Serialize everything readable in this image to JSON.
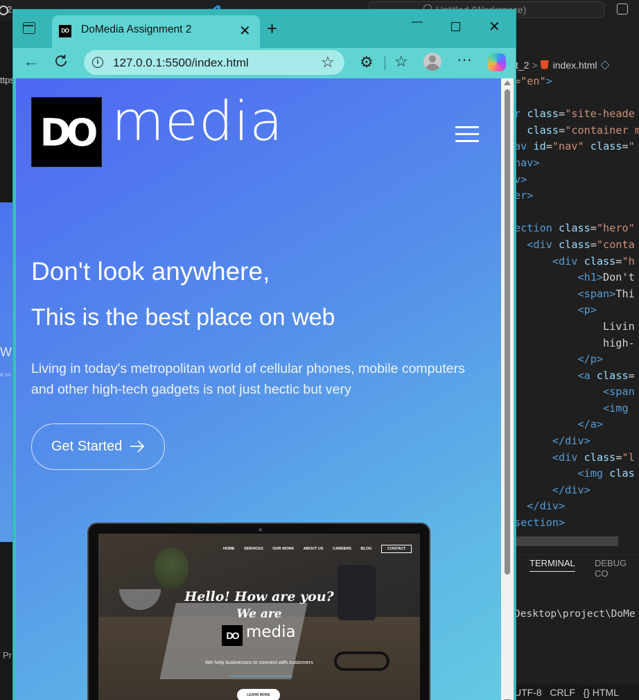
{
  "background": {
    "vscode": {
      "tab_number": "2",
      "workspace_search": "Untitled (Workspace)",
      "left_fragment_url": "ttps",
      "left_fragment_heading": "W",
      "left_fragment_small": "e co",
      "left_fragment_footer": "Pr",
      "editor_tab": {
        "left_text": "t_2",
        "file": "index.html"
      },
      "code_lines": [
        {
          "indent": 0,
          "html": "<span class='str'>=\"en\"</span><span class='tag'>&gt;</span>"
        },
        {
          "indent": 0,
          "html": " "
        },
        {
          "indent": 0,
          "html": "<span class='tag'>r</span> <span class='attr'>class</span>=<span class='str'>\"site-heade</span>"
        },
        {
          "indent": 0,
          "html": "  <span class='attr'>class</span>=<span class='str'>\"container m</span>"
        },
        {
          "indent": 0,
          "html": "<span class='tag'>av</span> <span class='attr'>id</span>=<span class='str'>\"nav\"</span> <span class='attr'>class</span>=<span class='str'>\"</span>"
        },
        {
          "indent": 0,
          "html": "<span class='tag'>nav&gt;</span>"
        },
        {
          "indent": 0,
          "html": "<span class='tag'>v&gt;</span>"
        },
        {
          "indent": 0,
          "html": "<span class='tag'>er&gt;</span>"
        },
        {
          "indent": 0,
          "html": " "
        },
        {
          "indent": 0,
          "html": "<span class='tag'>ection</span> <span class='attr'>class</span>=<span class='str'>\"hero\"</span>"
        },
        {
          "indent": 1,
          "html": "<span class='tag'>&lt;div</span> <span class='attr'>class</span>=<span class='str'>\"conta</span>"
        },
        {
          "indent": 2,
          "html": "<span class='tag'>&lt;div</span> <span class='attr'>class</span>=<span class='str'>\"h</span>"
        },
        {
          "indent": 3,
          "html": "<span class='tag'>&lt;h1&gt;</span><span class='txt'>Don't</span>"
        },
        {
          "indent": 3,
          "html": "<span class='tag'>&lt;span&gt;</span><span class='txt'>Thi</span>"
        },
        {
          "indent": 3,
          "html": "<span class='tag'>&lt;p&gt;</span>"
        },
        {
          "indent": 4,
          "html": "<span class='txt'>Livin</span>"
        },
        {
          "indent": 4,
          "html": "<span class='txt'>high-</span>"
        },
        {
          "indent": 3,
          "html": "<span class='tag'>&lt;/p&gt;</span>"
        },
        {
          "indent": 3,
          "html": "<span class='tag'>&lt;a</span> <span class='attr'>class</span>="
        },
        {
          "indent": 4,
          "html": "<span class='tag'>&lt;span</span>"
        },
        {
          "indent": 4,
          "html": "<span class='tag'>&lt;img</span>"
        },
        {
          "indent": 3,
          "html": "<span class='tag'>&lt;/a&gt;</span>"
        },
        {
          "indent": 2,
          "html": "<span class='tag'>&lt;/div&gt;</span>"
        },
        {
          "indent": 2,
          "html": "<span class='tag'>&lt;div</span> <span class='attr'>class</span>=<span class='str'>\"l</span>"
        },
        {
          "indent": 3,
          "html": "<span class='tag'>&lt;img</span> <span class='attr'>clas</span>"
        },
        {
          "indent": 2,
          "html": "<span class='tag'>&lt;/div&gt;</span>"
        },
        {
          "indent": 1,
          "html": "<span class='tag'>&lt;/div&gt;</span>"
        },
        {
          "indent": 0,
          "html": "<span class='tag'>section&gt;</span>"
        }
      ],
      "terminal_tab_active": "TERMINAL",
      "terminal_tab_other": "DEBUG CO",
      "terminal_line": "Desktop\\project\\DoMe",
      "status_bar": "UTF-8   CRLF   {} HTML"
    }
  },
  "browser": {
    "tab_title": "DoMedia Assignment 2",
    "tab_favicon_text": "DO",
    "tab_close": "✕",
    "new_tab": "+",
    "window_minimize": "—",
    "window_close": "✕",
    "url": "127.0.0.1:5500/index.html",
    "info_icon_text": "i",
    "favorite_star": "☆",
    "extensions_icon": "⚙",
    "favorites_icon": "☆",
    "more_icon": "···",
    "back_icon": "←"
  },
  "page": {
    "logo_box_text": "DO",
    "logo_word": "media",
    "hero": {
      "heading": "Don't look anywhere,",
      "subheading": "This is the best place on web",
      "description": "Living in today's metropolitan world of cellular phones, mobile computers and other high-tech gadgets is not just hectic but very",
      "cta_label": "Get Started"
    },
    "mockup": {
      "nav": [
        "HOME",
        "SERVICES",
        "OUR WORK",
        "ABOUT US",
        "CAREERS",
        "BLOG"
      ],
      "nav_contact": "CONTACT",
      "hello": "Hello! How are you?",
      "we_are": "We are",
      "logo_box_text": "DO",
      "logo_word": "media",
      "tagline": "We help businesses to connect with customers",
      "button": "LEARN MORE"
    }
  },
  "colors": {
    "browser_frame": "#36b6b7",
    "toolbar": "#5fd4d2",
    "address_bar": "#a6ebea",
    "page_gradient_start": "#4e67f3",
    "page_gradient_end": "#63cbe2"
  }
}
